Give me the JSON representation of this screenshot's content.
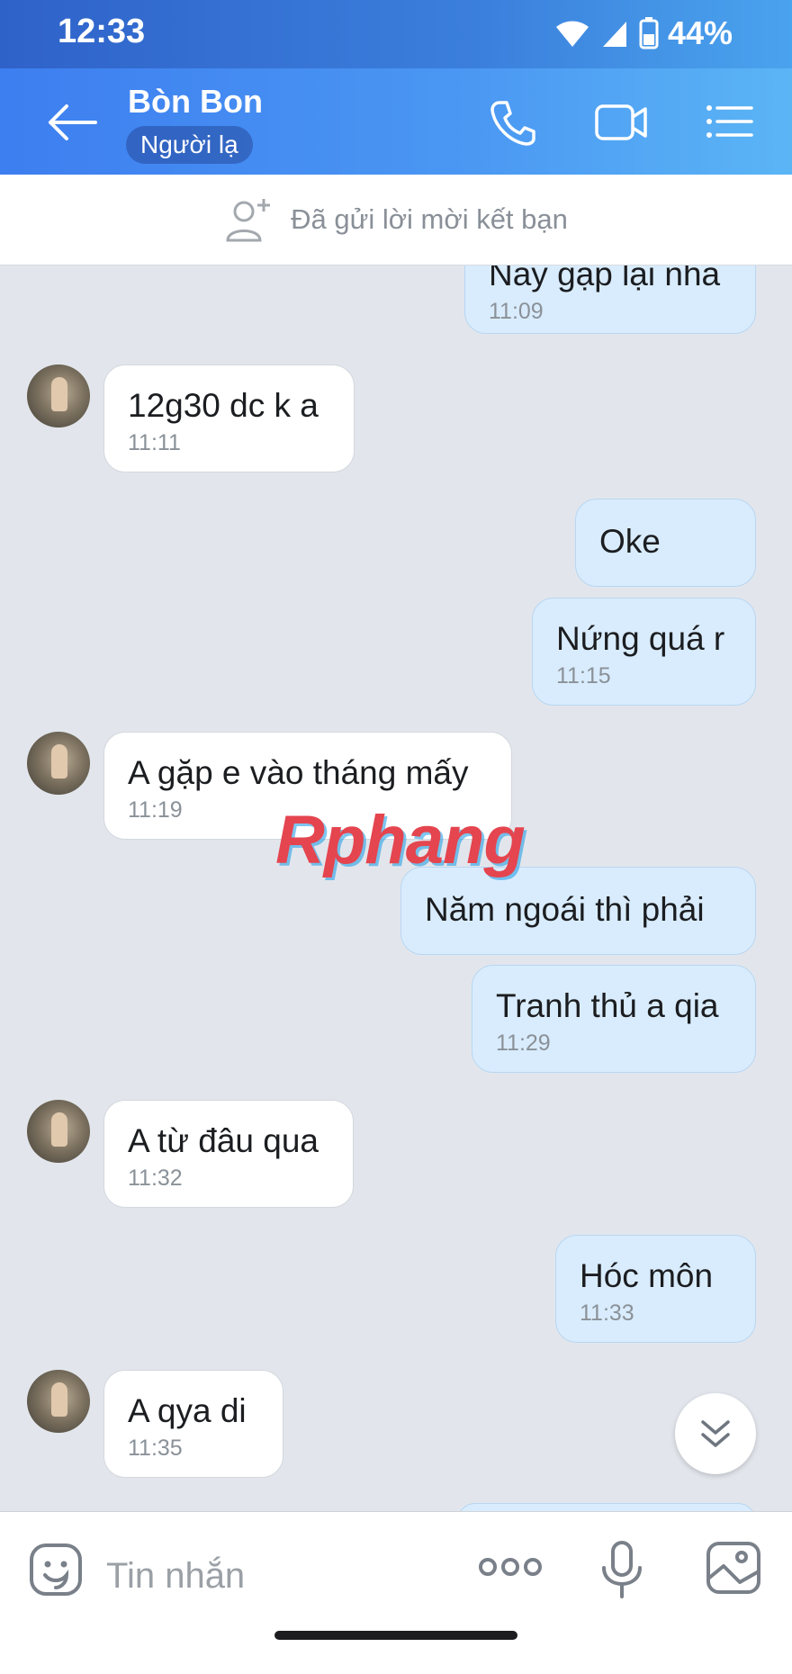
{
  "status": {
    "time": "12:33",
    "battery": "44%"
  },
  "header": {
    "contact_name": "Bòn Bon",
    "badge": "Người lạ"
  },
  "friend_request": {
    "text": "Đã gửi lời mời kết bạn"
  },
  "messages": [
    {
      "dir": "out",
      "text": "Nãy gặp lại nha",
      "time": "11:09"
    },
    {
      "dir": "in",
      "text": "12g30 dc k a",
      "time": "11:11"
    },
    {
      "dir": "out",
      "text": "Oke",
      "time": ""
    },
    {
      "dir": "out",
      "text": "Nứng quá r",
      "time": "11:15"
    },
    {
      "dir": "in",
      "text": "A gặp e vào tháng mấy",
      "time": "11:19"
    },
    {
      "dir": "out",
      "text": "Năm ngoái thì phải",
      "time": ""
    },
    {
      "dir": "out",
      "text": "Tranh thủ a qia",
      "time": "11:29"
    },
    {
      "dir": "in",
      "text": "A từ đâu qua",
      "time": "11:32"
    },
    {
      "dir": "out",
      "text": "Hóc môn",
      "time": "11:33"
    },
    {
      "dir": "in",
      "text": "A qya di",
      "time": "11:35"
    }
  ],
  "watermark": "Rphang",
  "composer": {
    "placeholder": "Tin nhắn"
  }
}
